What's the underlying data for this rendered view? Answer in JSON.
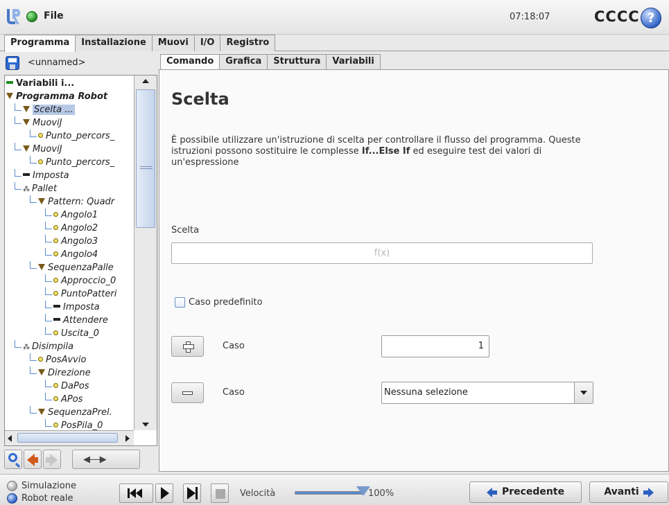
{
  "header": {
    "file_label": "File",
    "clock": "07:18:07",
    "robot_name": "CCCC",
    "help": "?"
  },
  "main_tabs": [
    {
      "label": "Programma",
      "active": true
    },
    {
      "label": "Installazione",
      "active": false
    },
    {
      "label": "Muovi",
      "active": false
    },
    {
      "label": "I/O",
      "active": false
    },
    {
      "label": "Registro",
      "active": false
    }
  ],
  "program": {
    "name": "<unnamed>"
  },
  "tree": [
    {
      "label": "Variabili i...",
      "icon": "dash-green",
      "indent": 0,
      "style": "bold"
    },
    {
      "label": "Programma Robot",
      "icon": "triangle",
      "indent": 0,
      "style": "bolditalic"
    },
    {
      "label": "Scelta ...",
      "icon": "triangle",
      "indent": 1,
      "selected": true
    },
    {
      "label": "MuoviJ",
      "icon": "triangle",
      "indent": 1
    },
    {
      "label": "Punto_percors_",
      "icon": "dot",
      "indent": 2
    },
    {
      "label": "MuoviJ",
      "icon": "triangle",
      "indent": 1
    },
    {
      "label": "Punto_percors_",
      "icon": "dot",
      "indent": 2
    },
    {
      "label": "Imposta",
      "icon": "dash",
      "indent": 1
    },
    {
      "label": "Pallet",
      "icon": "pallet",
      "indent": 1
    },
    {
      "label": "Pattern: Quadr",
      "icon": "triangle",
      "indent": 2
    },
    {
      "label": "Angolo1",
      "icon": "dot",
      "indent": 3
    },
    {
      "label": "Angolo2",
      "icon": "dot",
      "indent": 3
    },
    {
      "label": "Angolo3",
      "icon": "dot",
      "indent": 3
    },
    {
      "label": "Angolo4",
      "icon": "dot",
      "indent": 3
    },
    {
      "label": "SequenzaPalle",
      "icon": "triangle",
      "indent": 2
    },
    {
      "label": "Approccio_0",
      "icon": "dot",
      "indent": 3
    },
    {
      "label": "PuntoPatteri",
      "icon": "dot",
      "indent": 3
    },
    {
      "label": "Imposta",
      "icon": "dash",
      "indent": 3
    },
    {
      "label": "Attendere",
      "icon": "dash",
      "indent": 3
    },
    {
      "label": "Uscita_0",
      "icon": "dot",
      "indent": 3
    },
    {
      "label": "Disimpila",
      "icon": "pallet",
      "indent": 1
    },
    {
      "label": "PosAvvio",
      "icon": "dot",
      "indent": 2
    },
    {
      "label": "Direzione",
      "icon": "triangle",
      "indent": 2
    },
    {
      "label": "DaPos",
      "icon": "dot",
      "indent": 3
    },
    {
      "label": "APos",
      "icon": "dot",
      "indent": 3
    },
    {
      "label": "SequenzaPrel.",
      "icon": "triangle",
      "indent": 2
    },
    {
      "label": "PosPila_0",
      "icon": "dot",
      "indent": 3
    }
  ],
  "tools": {
    "move_arrows": "◀----▶"
  },
  "sub_tabs": [
    {
      "label": "Comando",
      "active": true
    },
    {
      "label": "Grafica",
      "active": false
    },
    {
      "label": "Struttura",
      "active": false
    },
    {
      "label": "Variabili",
      "active": false
    }
  ],
  "command": {
    "title": "Scelta",
    "description_1": "È possibile utilizzare un'istruzione di scelta per controllare il flusso del programma. Queste istruzioni possono sostituire le complesse ",
    "description_bold": "If...Else If",
    "description_2": " ed eseguire test dei valori di un'espressione",
    "expression_label": "Scelta",
    "expression_placeholder": "f(x)",
    "default_case_label": "Caso predefinito",
    "default_case_checked": false,
    "add_case_label": "Caso",
    "add_case_value": "1",
    "remove_case_label": "Caso",
    "remove_case_selected": "Nessuna selezione"
  },
  "footer": {
    "simulation_label": "Simulazione",
    "real_robot_label": "Robot reale",
    "mode_selected": "Robot reale",
    "speed_label": "Velocità",
    "speed_value": "100%",
    "speed_fraction": 1.0,
    "prev_label": "Precedente",
    "next_label": "Avanti"
  },
  "colors": {
    "accent": "#2c5fc2",
    "power_on": "#1d8a1d",
    "selection": "#b6c8e6"
  }
}
